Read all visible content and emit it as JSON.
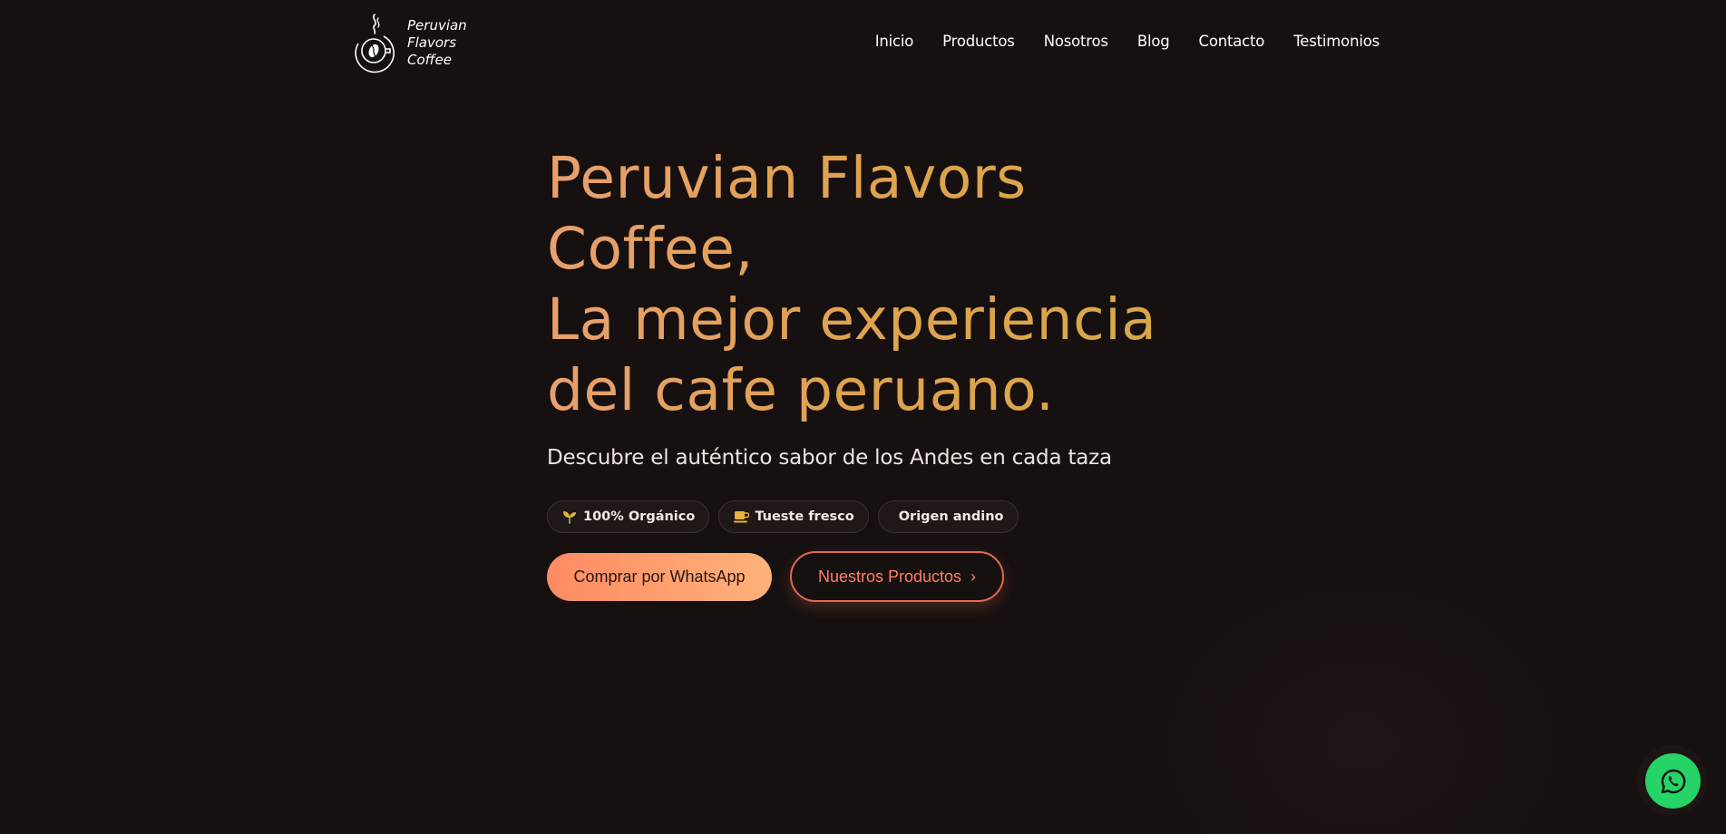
{
  "brand": {
    "line1": "Peruvian",
    "line2": "Flavors",
    "line3": "Coffee"
  },
  "nav": {
    "items": [
      {
        "label": "Inicio"
      },
      {
        "label": "Productos"
      },
      {
        "label": "Nosotros"
      },
      {
        "label": "Blog"
      },
      {
        "label": "Contacto"
      },
      {
        "label": "Testimonios"
      }
    ]
  },
  "hero": {
    "title_lines": [
      "Peruvian Flavors",
      "Coffee,",
      "La mejor experiencia",
      "del cafe peruano."
    ],
    "subtitle": "Descubre el auténtico sabor de los Andes en cada taza",
    "badges": [
      {
        "icon": "sprout-icon",
        "label": "100% Orgánico"
      },
      {
        "icon": "coffee-cup-icon",
        "label": "Tueste fresco"
      },
      {
        "icon": "",
        "label": "Origen andino"
      }
    ],
    "primary_cta": "Comprar por WhatsApp",
    "secondary_cta": "Nuestros Productos",
    "secondary_cta_arrow": "›"
  },
  "colors": {
    "background": "#161010",
    "title_gradient_start": "#e9a06e",
    "title_gradient_end": "#d6aa45",
    "accent": "#ff8a62",
    "whatsapp": "#25d366"
  }
}
